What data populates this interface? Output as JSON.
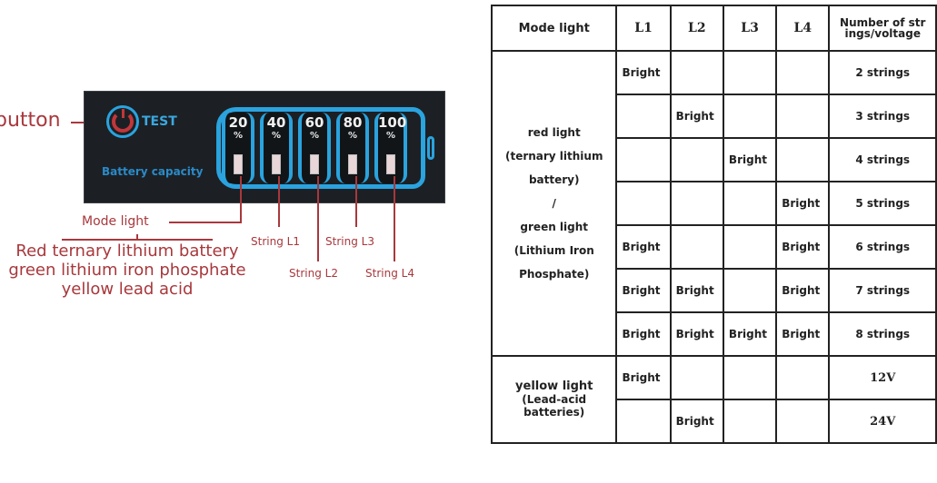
{
  "diagram": {
    "button_label": "button",
    "test_label": "TEST",
    "capacity_label": "Battery capacity",
    "cells": [
      {
        "pct": "20",
        "sign": "%"
      },
      {
        "pct": "40",
        "sign": "%"
      },
      {
        "pct": "60",
        "sign": "%"
      },
      {
        "pct": "80",
        "sign": "%"
      },
      {
        "pct": "100",
        "sign": "%"
      }
    ],
    "mode_light_label": "Mode light",
    "mode_description": [
      "Red ternary lithium battery",
      "green lithium iron phosphate",
      "yellow lead acid"
    ],
    "strings": [
      "String L1",
      "String L2",
      "String L3",
      "String L4"
    ],
    "colors": {
      "annotation": "#a8383c",
      "panel": "#1c2024",
      "accent_blue": "#2aa3de",
      "power_red": "#c0373b"
    }
  },
  "table": {
    "headers": [
      "Mode light",
      "L1",
      "L2",
      "L3",
      "L4",
      "Number of strings/voltage"
    ],
    "header_last_line1": "Number of str",
    "header_last_line2": "ings/voltage",
    "groups": [
      {
        "mode_lines": [
          "red light",
          "(ternary lithium",
          "battery)",
          "/",
          "green light",
          "(Lithium Iron",
          "Phosphate)"
        ],
        "rows": [
          {
            "L1": "Bright",
            "L2": "",
            "L3": "",
            "L4": "",
            "value": "2 strings"
          },
          {
            "L1": "",
            "L2": "Bright",
            "L3": "",
            "L4": "",
            "value": "3 strings"
          },
          {
            "L1": "",
            "L2": "",
            "L3": "Bright",
            "L4": "",
            "value": "4 strings"
          },
          {
            "L1": "",
            "L2": "",
            "L3": "",
            "L4": "Bright",
            "value": "5 strings"
          },
          {
            "L1": "Bright",
            "L2": "",
            "L3": "",
            "L4": "Bright",
            "value": "6 strings"
          },
          {
            "L1": "Bright",
            "L2": "Bright",
            "L3": "",
            "L4": "Bright",
            "value": "7 strings"
          },
          {
            "L1": "Bright",
            "L2": "Bright",
            "L3": "Bright",
            "L4": "Bright",
            "value": "8 strings"
          }
        ]
      },
      {
        "mode_lines": [
          "yellow light",
          "(Lead-acid",
          "batteries)"
        ],
        "rows": [
          {
            "L1": "Bright",
            "L2": "",
            "L3": "",
            "L4": "",
            "value": "12V"
          },
          {
            "L1": "",
            "L2": "Bright",
            "L3": "",
            "L4": "",
            "value": "24V"
          }
        ]
      }
    ]
  }
}
